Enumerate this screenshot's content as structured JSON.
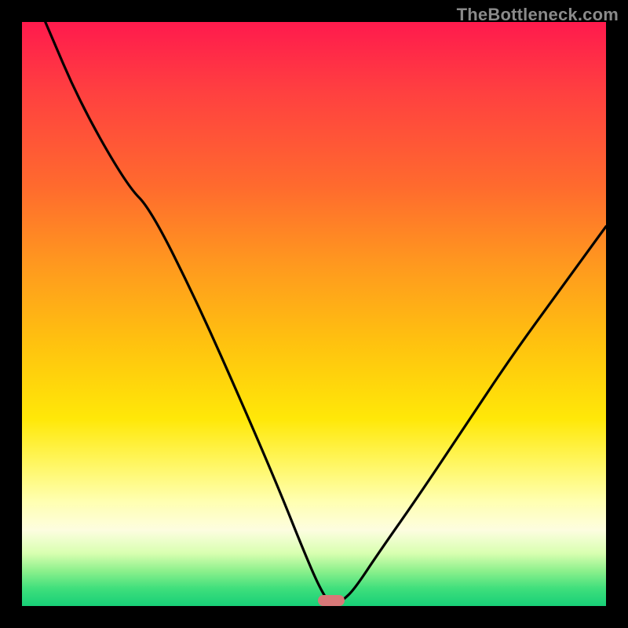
{
  "watermark": "TheBottleneck.com",
  "colors": {
    "frame": "#000000",
    "curve": "#000000",
    "min_marker": "#d87878",
    "gradient_stops": [
      "#ff1a4d",
      "#ff4040",
      "#ff6a2e",
      "#ff9a1e",
      "#ffc20f",
      "#ffe808",
      "#fff766",
      "#ffffb0",
      "#fdfde0",
      "#d8ffb0",
      "#8cf08c",
      "#3fdf7c",
      "#17cf77"
    ]
  },
  "chart_data": {
    "type": "line",
    "title": "",
    "xlabel": "",
    "ylabel": "",
    "xlim": [
      0,
      100
    ],
    "ylim": [
      0,
      100
    ],
    "legend": false,
    "grid": false,
    "min_marker_x": 53,
    "series": [
      {
        "name": "bottleneck-curve",
        "x": [
          4,
          10,
          18,
          22,
          30,
          38,
          44,
          48,
          51,
          53,
          55,
          57,
          61,
          68,
          76,
          84,
          92,
          100
        ],
        "values": [
          100,
          86,
          72,
          68,
          52,
          34,
          20,
          10,
          3,
          0,
          1,
          3,
          9,
          19,
          31,
          43,
          54,
          65
        ]
      }
    ]
  }
}
